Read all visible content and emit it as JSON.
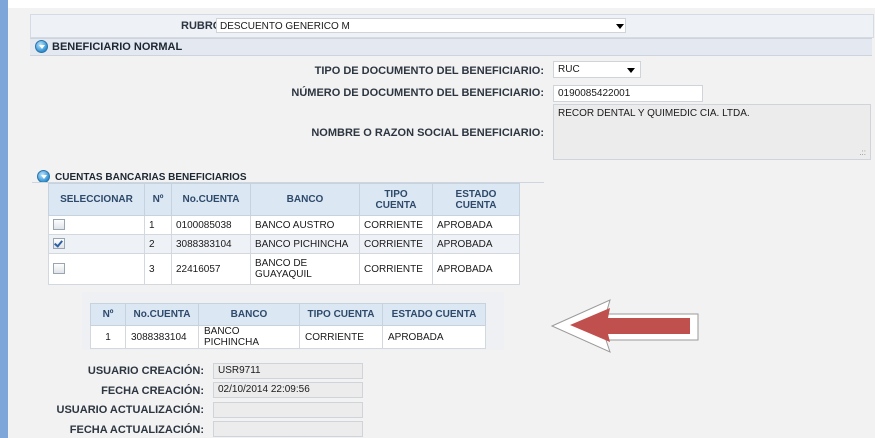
{
  "rubro": {
    "label": "RUBRO:",
    "value": "DESCUENTO GENERICO M"
  },
  "section": {
    "title": "BENEFICIARIO NORMAL"
  },
  "beneficiary": {
    "doc_type_label": "TIPO DE DOCUMENTO DEL BENEFICIARIO:",
    "doc_type_value": "RUC",
    "doc_number_label": "NÚMERO DE DOCUMENTO DEL BENEFICIARIO:",
    "doc_number_value": "0190085422001",
    "name_label": "NOMBRE O RAZON SOCIAL BENEFICIARIO:",
    "name_value": "RECOR DENTAL Y QUIMEDIC CIA. LTDA."
  },
  "accounts": {
    "title": "CUENTAS BANCARIAS BENEFICIARIOS",
    "headers": [
      "SELECCIONAR",
      "Nº",
      "No.CUENTA",
      "BANCO",
      "TIPO CUENTA",
      "ESTADO CUENTA"
    ],
    "rows": [
      {
        "selected": false,
        "n": "1",
        "cuenta": "0100085038",
        "banco": "BANCO AUSTRO",
        "tipo": "CORRIENTE",
        "estado": "APROBADA"
      },
      {
        "selected": true,
        "n": "2",
        "cuenta": "3088383104",
        "banco": "BANCO PICHINCHA",
        "tipo": "CORRIENTE",
        "estado": "APROBADA"
      },
      {
        "selected": false,
        "n": "3",
        "cuenta": "22416057",
        "banco": "BANCO DE GUAYAQUIL",
        "tipo": "CORRIENTE",
        "estado": "APROBADA"
      }
    ]
  },
  "selected_account": {
    "headers": [
      "Nº",
      "No.CUENTA",
      "BANCO",
      "TIPO CUENTA",
      "ESTADO CUENTA"
    ],
    "rows": [
      {
        "n": "1",
        "cuenta": "3088383104",
        "banco": "BANCO PICHINCHA",
        "tipo": "CORRIENTE",
        "estado": "APROBADA"
      }
    ]
  },
  "audit": {
    "created_by_label": "USUARIO CREACIÓN:",
    "created_by_value": "USR9711",
    "created_date_label": "FECHA CREACIÓN:",
    "created_date_value": "02/10/2014 22:09:56",
    "updated_by_label": "USUARIO ACTUALIZACIÓN:",
    "updated_by_value": "",
    "updated_date_label": "FECHA ACTUALIZACIÓN:",
    "updated_date_value": ""
  },
  "colors": {
    "arrow": "#c0504d",
    "header_bg": "#dce7f4",
    "sidebar": "#7ea6d8"
  },
  "icons": {
    "section": "collapse-circle-icon",
    "arrow": "left-arrow-icon"
  }
}
